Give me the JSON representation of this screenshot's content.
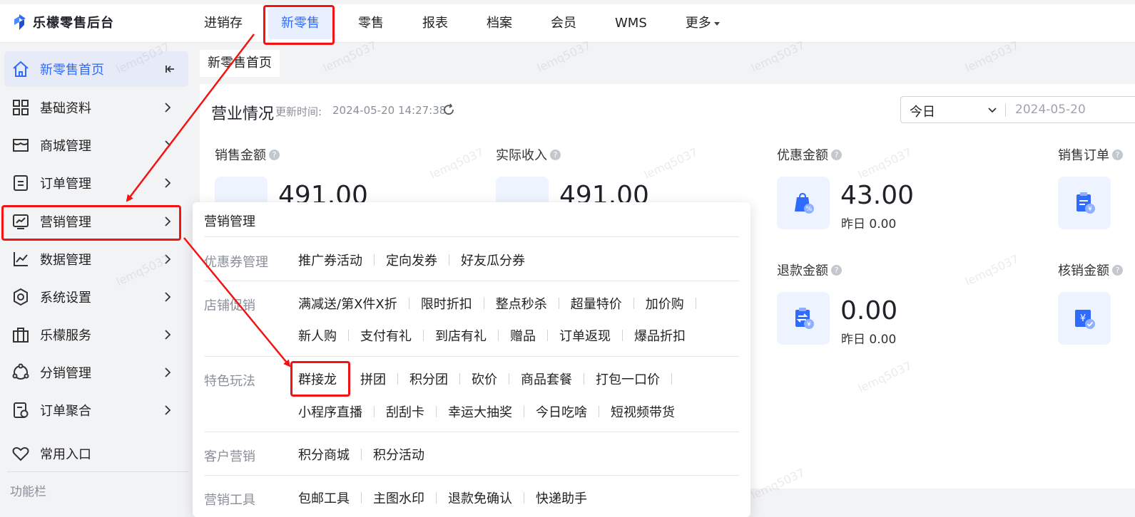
{
  "app": {
    "title": "乐檬零售后台"
  },
  "nav": {
    "items": [
      "进销存",
      "新零售",
      "零售",
      "报表",
      "档案",
      "会员",
      "WMS",
      "更多"
    ],
    "active": "新零售"
  },
  "sidebar": {
    "items": [
      {
        "label": "新零售首页",
        "icon": "home-icon"
      },
      {
        "label": "基础资料",
        "icon": "grid-icon"
      },
      {
        "label": "商城管理",
        "icon": "shop-icon"
      },
      {
        "label": "订单管理",
        "icon": "order-icon"
      },
      {
        "label": "营销管理",
        "icon": "marketing-icon"
      },
      {
        "label": "数据管理",
        "icon": "chart-icon"
      },
      {
        "label": "系统设置",
        "icon": "settings-icon"
      },
      {
        "label": "乐檬服务",
        "icon": "service-icon"
      },
      {
        "label": "分销管理",
        "icon": "distribution-icon"
      },
      {
        "label": "订单聚合",
        "icon": "aggregate-icon"
      },
      {
        "label": "常用入口",
        "icon": "heart-icon"
      }
    ],
    "footer_label": "功能栏"
  },
  "main": {
    "tab_label": "新零售首页",
    "card_title": "营业情况",
    "update_label": "更新时间:",
    "update_time": "2024-05-20 14:27:38",
    "date_range": "今日",
    "date_value": "2024-05-20",
    "metrics": [
      {
        "label": "销售金额",
        "value": "491.00"
      },
      {
        "label": "实际收入",
        "value": "491.00"
      },
      {
        "label": "优惠金额",
        "value": "43.00",
        "sub": "昨日 0.00"
      },
      {
        "label": "销售订单",
        "value": ""
      },
      {
        "label": "退款金额",
        "value": "0.00",
        "sub": "昨日 0.00"
      },
      {
        "label": "核销金额",
        "value": ""
      }
    ]
  },
  "popup": {
    "title": "营销管理",
    "groups": [
      {
        "label": "优惠券管理",
        "rows": [
          [
            "推广券活动",
            "定向发券",
            "好友瓜分券"
          ]
        ]
      },
      {
        "label": "店铺促销",
        "rows": [
          [
            "满减送/第X件X折",
            "限时折扣",
            "整点秒杀",
            "超量特价",
            "加价购"
          ],
          [
            "新人购",
            "支付有礼",
            "到店有礼",
            "赠品",
            "订单返现",
            "爆品折扣"
          ]
        ]
      },
      {
        "label": "特色玩法",
        "rows": [
          [
            "群接龙",
            "拼团",
            "积分团",
            "砍价",
            "商品套餐",
            "打包一口价"
          ],
          [
            "小程序直播",
            "刮刮卡",
            "幸运大抽奖",
            "今日吃啥",
            "短视频带货"
          ]
        ]
      },
      {
        "label": "客户营销",
        "rows": [
          [
            "积分商城",
            "积分活动"
          ]
        ]
      },
      {
        "label": "营销工具",
        "rows": [
          [
            "包邮工具",
            "主图水印",
            "退款免确认",
            "快递助手"
          ]
        ]
      }
    ]
  },
  "watermark": "lemq5037",
  "colors": {
    "accent": "#2f6bff",
    "annotation": "#f21414"
  }
}
